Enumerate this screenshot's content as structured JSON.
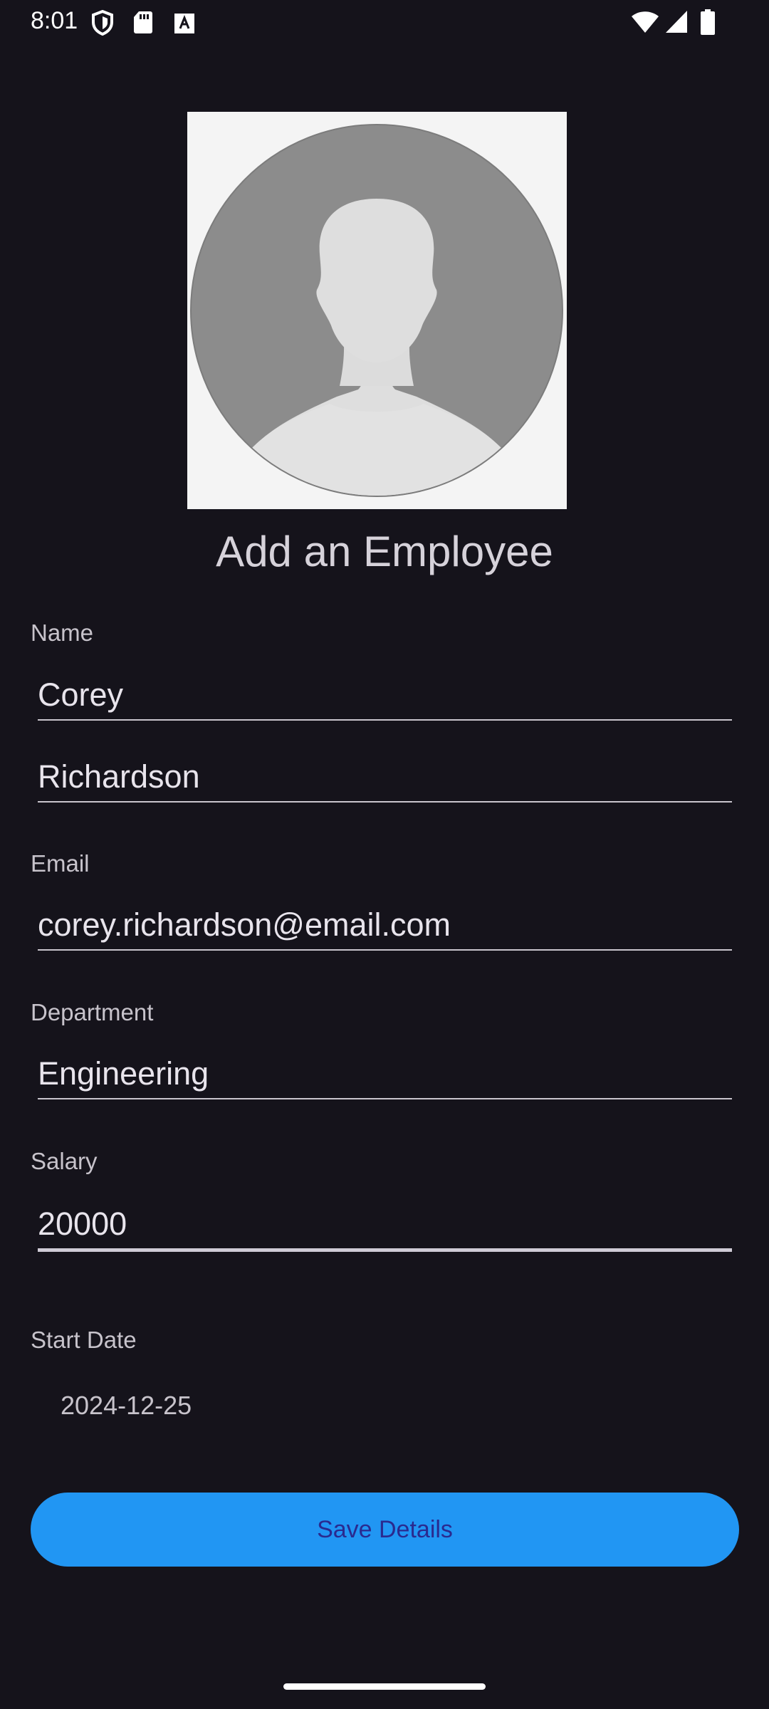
{
  "status_bar": {
    "time": "8:01",
    "left_icons": [
      "shield-icon",
      "sd-card-icon",
      "keyboard-a-icon"
    ],
    "right_icons": [
      "wifi-icon",
      "signal-icon",
      "battery-icon"
    ]
  },
  "avatar": {
    "icon": "person-placeholder-icon"
  },
  "title": "Add an Employee",
  "form": {
    "name_label": "Name",
    "first_name_value": "Corey",
    "last_name_value": "Richardson",
    "email_label": "Email",
    "email_value": "corey.richardson@email.com",
    "department_label": "Department",
    "department_value": "Engineering",
    "salary_label": "Salary",
    "salary_value": "20000",
    "start_date_label": "Start Date",
    "start_date_value": "2024-12-25"
  },
  "actions": {
    "save_label": "Save Details"
  },
  "colors": {
    "background": "#15131b",
    "accent_button": "#2196f3",
    "button_text": "#2a2a8f"
  }
}
